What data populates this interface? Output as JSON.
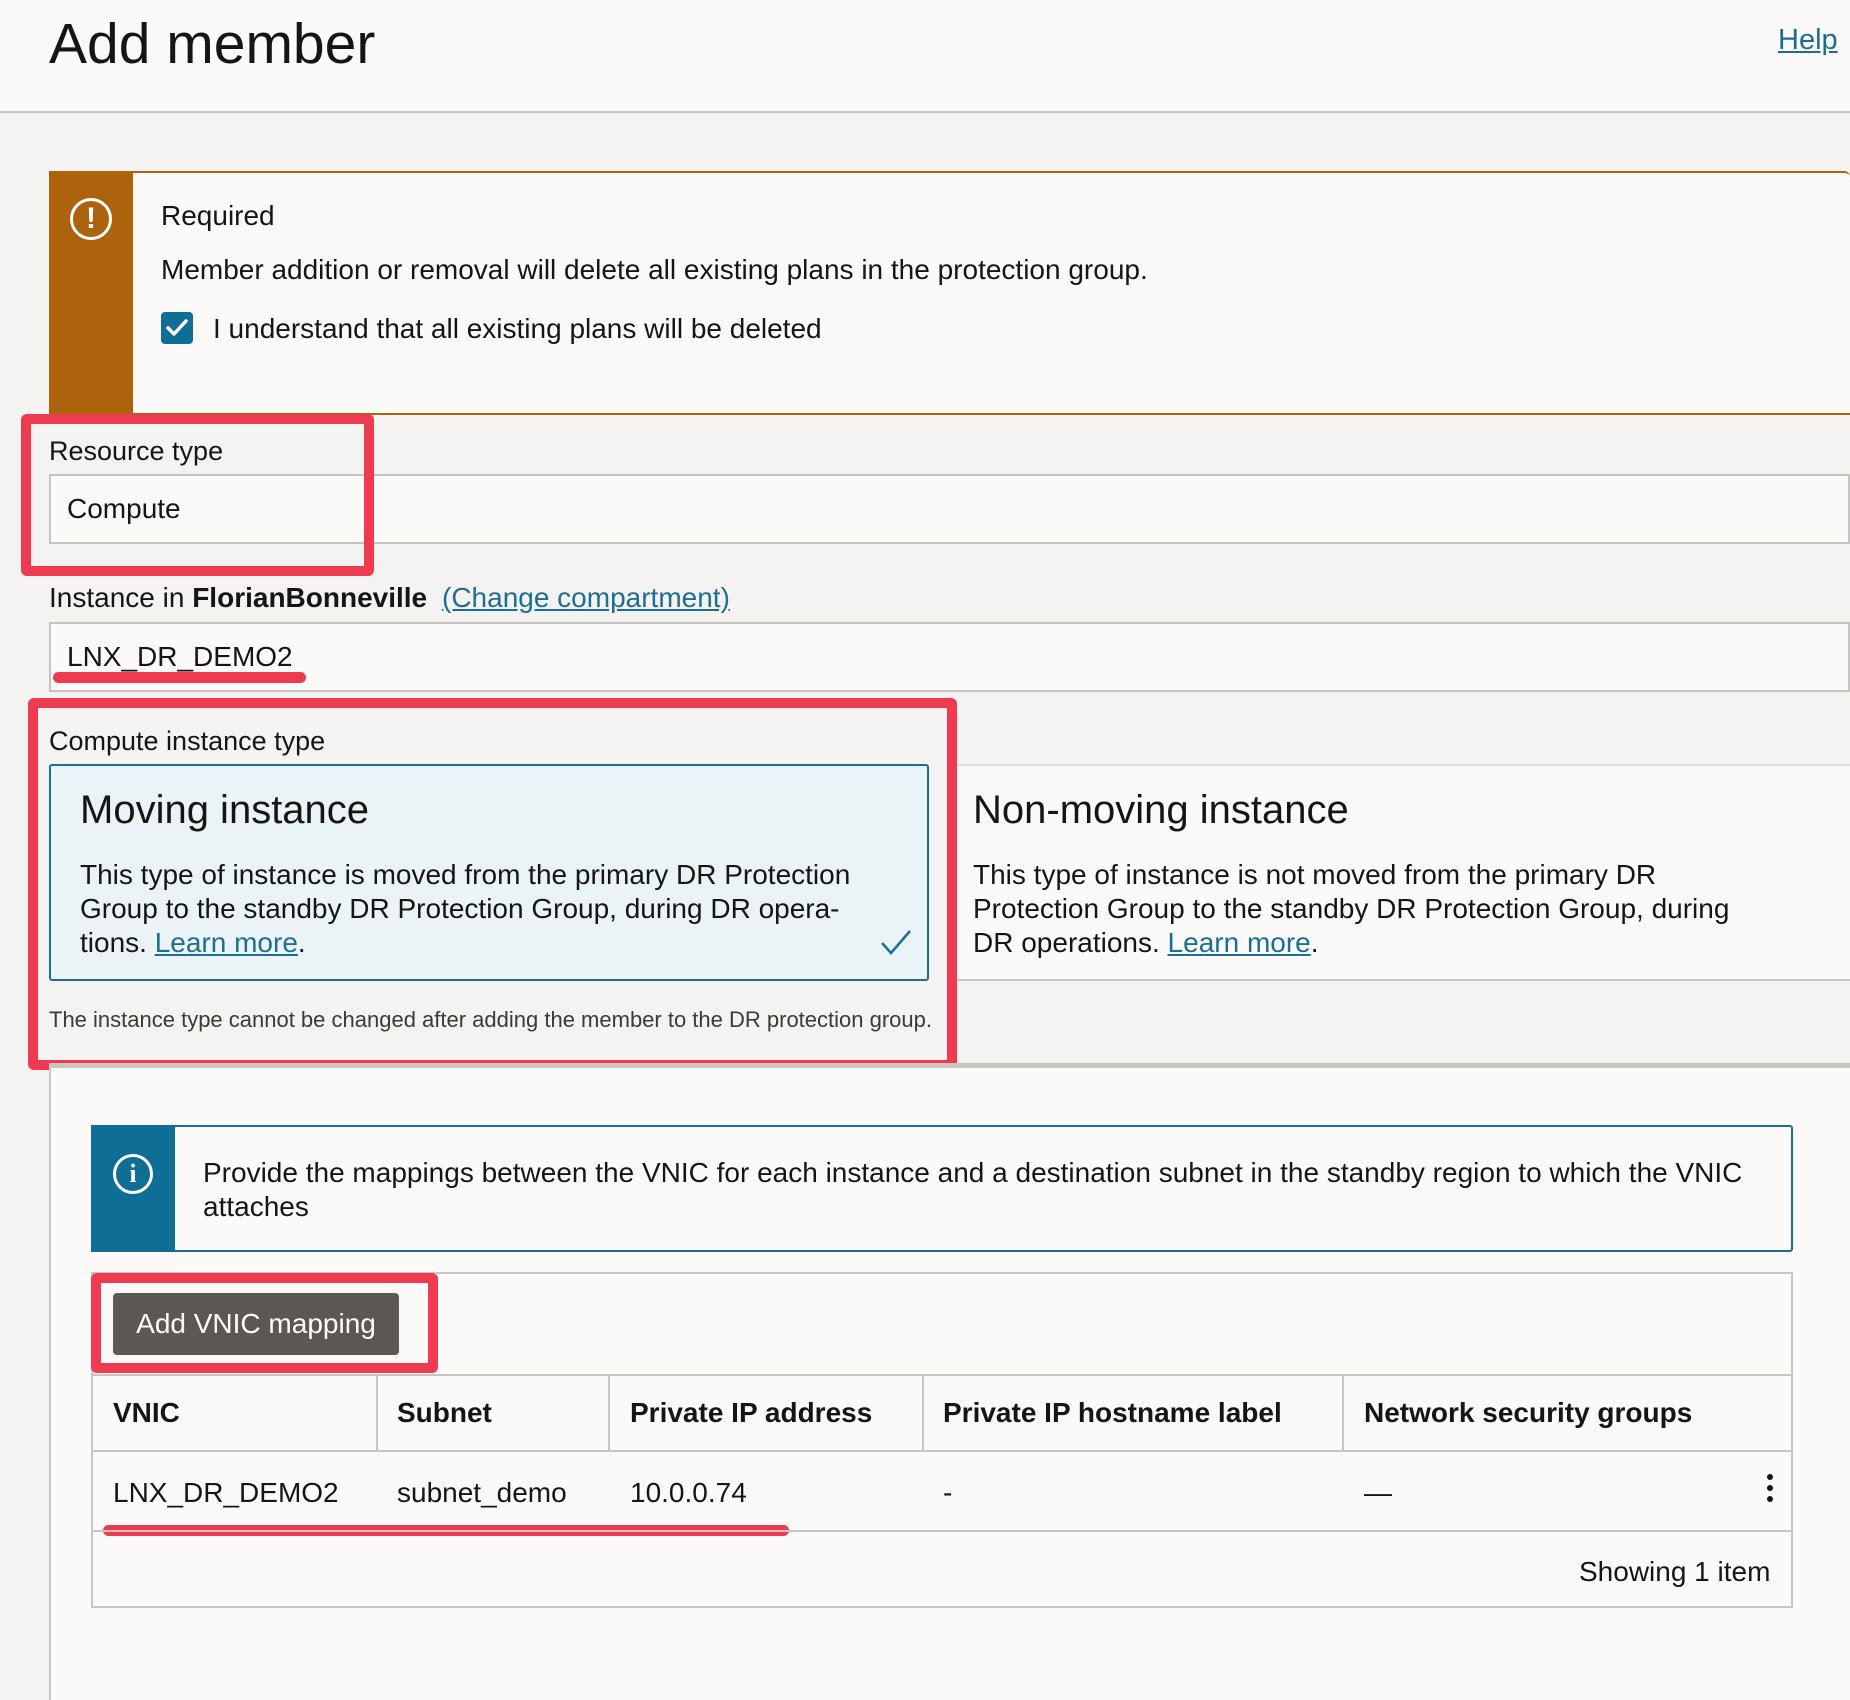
{
  "header": {
    "title": "Add member",
    "help": "Help"
  },
  "warning": {
    "title": "Required",
    "message": "Member addition or removal will delete all existing plans in the protection group.",
    "checkbox_label": "I understand that all existing plans will be deleted",
    "checked": true,
    "icon": "exclamation-icon"
  },
  "resource_type": {
    "label": "Resource type",
    "value": "Compute"
  },
  "instance": {
    "label_prefix": "Instance in",
    "compartment": "FlorianBonneville",
    "change_link": "(Change compartment)",
    "value": "LNX_DR_DEMO2"
  },
  "compute_type": {
    "label": "Compute instance type",
    "moving": {
      "title": "Moving instance",
      "description_line1": "This type of instance is moved from the primary DR Protection",
      "description_line2": "Group to the standby DR Protection Group, during DR opera-",
      "description_line3": "tions.",
      "learn_more": "Learn more",
      "selected": true
    },
    "non_moving": {
      "title": "Non-moving instance",
      "description_line1": "This type of instance is not moved from the primary DR",
      "description_line2": "Protection Group to the standby DR Protection Group, during",
      "description_line3": "DR operations.",
      "learn_more": "Learn more"
    },
    "note": "The instance type cannot be changed after adding the member to the DR protection group."
  },
  "vnic_info": {
    "text": "Provide the mappings between the VNIC for each instance and a destination subnet in the standby region to which the VNIC attaches",
    "icon": "info-icon"
  },
  "vnic_table": {
    "add_button": "Add VNIC mapping",
    "columns": [
      "VNIC",
      "Subnet",
      "Private IP address",
      "Private IP hostname label",
      "Network security groups"
    ],
    "rows": [
      {
        "vnic": "LNX_DR_DEMO2",
        "subnet": "subnet_demo",
        "private_ip": "10.0.0.74",
        "hostname_label": "-",
        "nsg": "—"
      }
    ],
    "footer": "Showing 1 item"
  },
  "colors": {
    "accent": "#1d6e93",
    "warning": "#ac630c",
    "annotation": "#ef3b51",
    "button": "#5d5753"
  }
}
